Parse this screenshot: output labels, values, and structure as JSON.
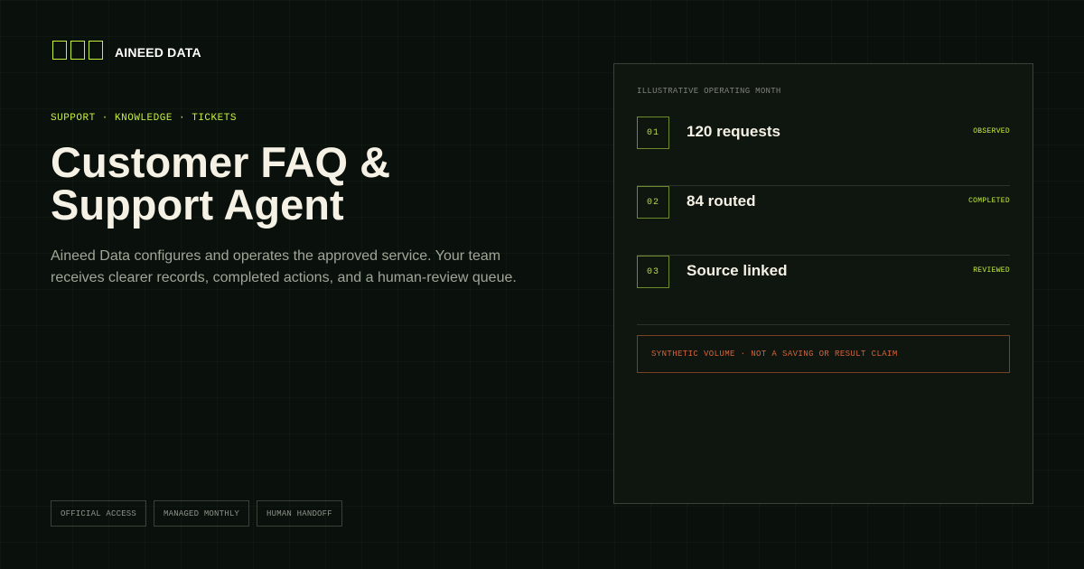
{
  "brand": {
    "name": "AINEED DATA",
    "logo_icons": [
      "square-outline-icon",
      "square-outline-icon",
      "square-outline-icon"
    ],
    "accent_color": "#c7ef3e"
  },
  "hero": {
    "eyebrow": "SUPPORT · KNOWLEDGE · TICKETS",
    "title_lines": [
      "Customer FAQ &",
      "Support Agent"
    ],
    "description_lines": [
      "Aineed Data configures and operates the approved service. Your team",
      "receives clearer records, completed actions, and a human-review queue."
    ]
  },
  "chips": [
    "OFFICIAL ACCESS",
    "MANAGED MONTHLY",
    "HUMAN HANDOFF"
  ],
  "panel": {
    "label": "ILLUSTRATIVE OPERATING MONTH",
    "rows": [
      {
        "number": "01",
        "text": "120 requests",
        "status": "OBSERVED"
      },
      {
        "number": "02",
        "text": "84 routed",
        "status": "COMPLETED"
      },
      {
        "number": "03",
        "text": "Source linked",
        "status": "REVIEWED"
      }
    ],
    "disclaimer": "SYNTHETIC VOLUME · NOT A SAVING OR RESULT CLAIM",
    "disclaimer_color": "#d8643a"
  }
}
